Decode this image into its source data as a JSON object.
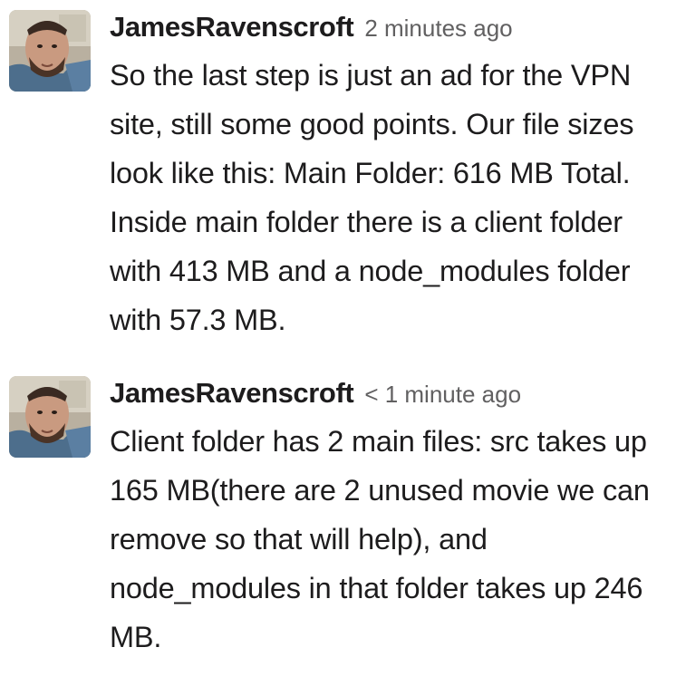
{
  "messages": [
    {
      "author": "JamesRavenscroft",
      "timestamp": "2 minutes ago",
      "text": "So the last step is just an ad for the VPN site, still some good points. Our file sizes look like this: Main Folder: 616 MB Total. Inside main folder there is a client folder with 413 MB and a node_modules folder with 57.3 MB."
    },
    {
      "author": "JamesRavenscroft",
      "timestamp": "< 1 minute ago",
      "text": "Client folder has 2 main files: src takes up 165 MB(there are 2 unused movie we can remove so that will help), and node_modules in that folder takes up 246 MB."
    }
  ]
}
